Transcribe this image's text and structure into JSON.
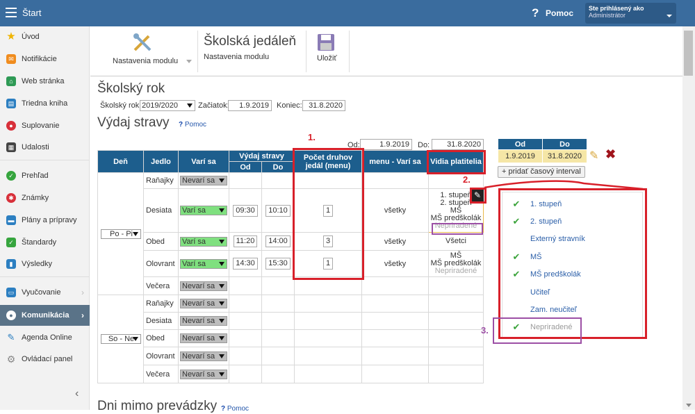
{
  "topbar": {
    "title": "Štart",
    "help": "Pomoc",
    "user_line1": "Ste prihlásený ako",
    "user_line2": "Administrátor"
  },
  "sidebar": {
    "items": [
      {
        "label": "Úvod",
        "icon": "star-icon",
        "color": "#f0b400"
      },
      {
        "label": "Notifikácie",
        "icon": "envelope-icon",
        "color": "#f08c1e"
      },
      {
        "label": "Web stránka",
        "icon": "house-icon",
        "color": "#2e9a55"
      },
      {
        "label": "Triedna kniha",
        "icon": "book-icon",
        "color": "#2c7fc1"
      },
      {
        "label": "Suplovanie",
        "icon": "person-icon",
        "color": "#d8303a"
      },
      {
        "label": "Udalosti",
        "icon": "calendar-icon",
        "color": "#444444"
      },
      {
        "label": "Prehľad",
        "icon": "check-circle-icon",
        "color": "#36a53e"
      },
      {
        "label": "Známky",
        "icon": "badge-icon",
        "color": "#d8303a"
      },
      {
        "label": "Plány a prípravy",
        "icon": "briefcase-icon",
        "color": "#2c7fc1"
      },
      {
        "label": "Štandardy",
        "icon": "shield-icon",
        "color": "#36a53e"
      },
      {
        "label": "Výsledky",
        "icon": "bar-chart-icon",
        "color": "#2c7fc1"
      },
      {
        "label": "Vyučovanie",
        "icon": "book-open-icon",
        "color": "#2c7fc1"
      },
      {
        "label": "Komunikácia",
        "icon": "chat-icon",
        "color": "#ffffff"
      },
      {
        "label": "Agenda Online",
        "icon": "pen-icon",
        "color": "#2c7fc1"
      },
      {
        "label": "Ovládací panel",
        "icon": "gear-icon",
        "color": "#888888"
      }
    ]
  },
  "toolbar": {
    "settings_label": "Nastavenia modulu",
    "module_title": "Školská jedáleň",
    "module_sub": "Nastavenia modulu",
    "save_label": "Uložiť"
  },
  "school_year": {
    "heading": "Školský rok",
    "year_label": "Školský rok:",
    "year_value": "2019/2020",
    "start_label": "Začiatok:",
    "start_value": "1.9.2019",
    "end_label": "Koniec:",
    "end_value": "31.8.2020"
  },
  "vydaj": {
    "heading": "Výdaj stravy",
    "help": "Pomoc",
    "od_label": "Od:",
    "od_value": "1.9.2019",
    "do_label": "Do:",
    "do_value": "31.8.2020"
  },
  "table": {
    "headers": {
      "den": "Deň",
      "jedlo": "Jedlo",
      "vari": "Varí sa",
      "vydaj": "Výdaj stravy",
      "od": "Od",
      "do": "Do",
      "pocet": "Počet druhov jedál (menu)",
      "menu": "menu - Varí sa",
      "platitelia": "Vidia platitelia"
    },
    "group1_day": "Po - Pi",
    "group2_day": "So - Ne",
    "rows1": [
      {
        "jedlo": "Raňajky",
        "vari": "Nevarí sa",
        "on": false
      },
      {
        "jedlo": "Desiata",
        "vari": "Varí sa",
        "on": true,
        "od": "09:30",
        "do": "10:10",
        "pocet": "1",
        "menu": "všetky",
        "plat": [
          "1. stupeň",
          "2. stupeň",
          "MŠ",
          "MŠ predškolák"
        ],
        "plat_grey": "Nepriradené"
      },
      {
        "jedlo": "Obed",
        "vari": "Varí sa",
        "on": true,
        "od": "11:20",
        "do": "14:00",
        "pocet": "3",
        "menu": "všetky",
        "plat": [
          "Všetci"
        ],
        "plat_grey": ""
      },
      {
        "jedlo": "Olovrant",
        "vari": "Varí sa",
        "on": true,
        "od": "14:30",
        "do": "15:30",
        "pocet": "1",
        "menu": "všetky",
        "plat": [
          "MŠ",
          "MŠ predškolák"
        ],
        "plat_grey": "Nepriradené"
      },
      {
        "jedlo": "Večera",
        "vari": "Nevarí sa",
        "on": false
      }
    ],
    "rows2": [
      {
        "jedlo": "Raňajky",
        "vari": "Nevarí sa"
      },
      {
        "jedlo": "Desiata",
        "vari": "Nevarí sa"
      },
      {
        "jedlo": "Obed",
        "vari": "Nevarí sa"
      },
      {
        "jedlo": "Olovrant",
        "vari": "Nevarí sa"
      },
      {
        "jedlo": "Večera",
        "vari": "Nevarí sa"
      }
    ]
  },
  "interval": {
    "od_header": "Od",
    "do_header": "Do",
    "od_value": "1.9.2019",
    "do_value": "31.8.2020",
    "add_button": "+ pridať časový interval"
  },
  "popup": {
    "items": [
      {
        "label": "1. stupeň",
        "checked": true,
        "grey": false
      },
      {
        "label": "2. stupeň",
        "checked": true,
        "grey": false
      },
      {
        "label": "Externý stravník",
        "checked": false,
        "grey": false
      },
      {
        "label": "MŠ",
        "checked": true,
        "grey": false
      },
      {
        "label": "MŠ predškolák",
        "checked": true,
        "grey": false
      },
      {
        "label": "Učiteľ",
        "checked": false,
        "grey": false
      },
      {
        "label": "Zam. neučiteľ",
        "checked": false,
        "grey": false
      },
      {
        "label": "Nepriradené",
        "checked": true,
        "grey": true
      }
    ]
  },
  "annotations": {
    "n1": "1.",
    "n2": "2.",
    "n3": "3."
  },
  "footer_heading": {
    "text": "Dni mimo prevádzky",
    "help": "Pomoc"
  }
}
